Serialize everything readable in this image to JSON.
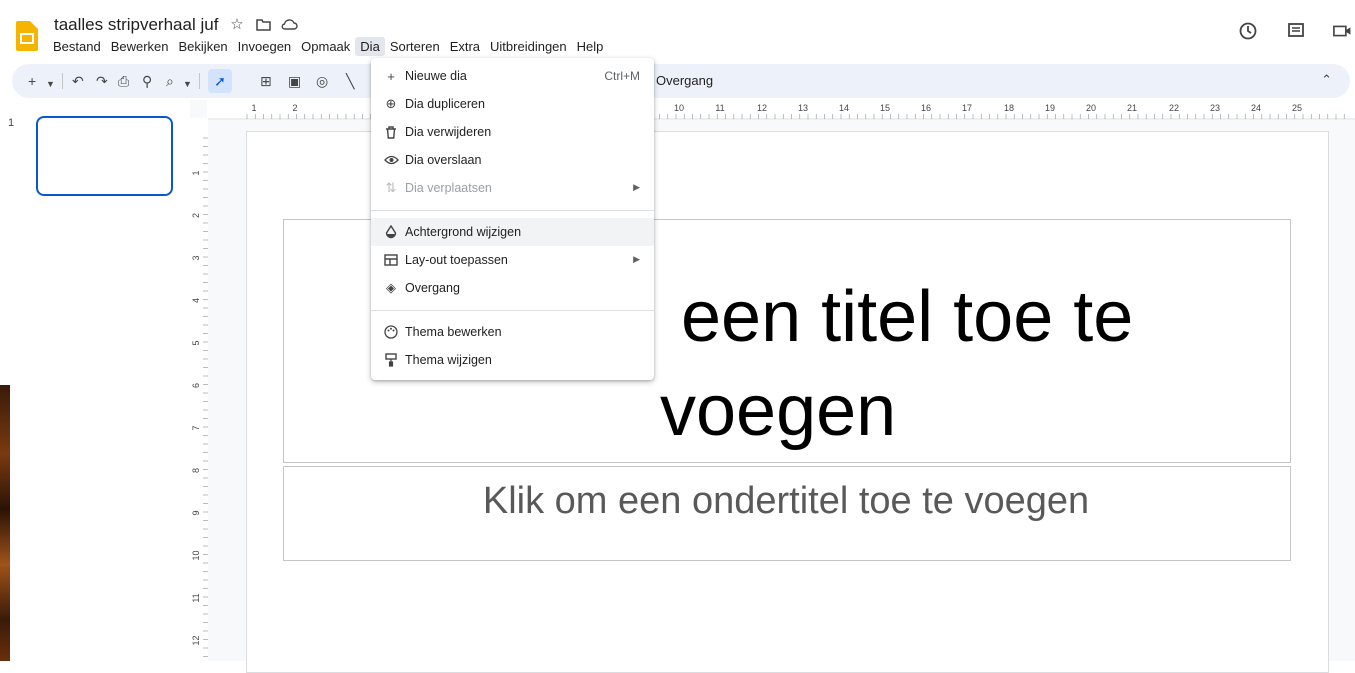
{
  "app": {
    "doc_title": "taalles stripverhaal juf",
    "menus": [
      "Bestand",
      "Bewerken",
      "Bekijken",
      "Invoegen",
      "Opmaak",
      "Dia",
      "Sorteren",
      "Extra",
      "Uitbreidingen",
      "Help"
    ],
    "active_menu": "Dia"
  },
  "toolbar": {
    "transition_label": "Overgang",
    "icons": [
      "plus-icon",
      "dropdown-icon",
      "undo-icon",
      "redo-icon",
      "print-icon",
      "paint-format-icon",
      "zoom-icon",
      "select-icon",
      "textbox-icon",
      "image-icon",
      "shape-icon",
      "line-icon"
    ]
  },
  "ruler": {
    "h_labels": [
      "1",
      "2",
      "10",
      "11",
      "12",
      "13",
      "14",
      "15",
      "16",
      "17",
      "18",
      "19",
      "20",
      "21",
      "22",
      "23",
      "24",
      "25"
    ],
    "v_labels": [
      "1",
      "2",
      "3",
      "4",
      "5",
      "6",
      "7",
      "8",
      "9",
      "10",
      "11",
      "12"
    ]
  },
  "filmstrip": {
    "slide_number": "1"
  },
  "slide": {
    "title_line1": "een titel toe te",
    "title_line2": "voegen",
    "subtitle": "Klik om een ondertitel toe te voegen"
  },
  "dia_menu": {
    "items": [
      {
        "label": "Nieuwe dia",
        "shortcut": "Ctrl+M",
        "icon": "plus-icon"
      },
      {
        "label": "Dia dupliceren",
        "icon": "duplicate-icon"
      },
      {
        "label": "Dia verwijderen",
        "icon": "trash-icon"
      },
      {
        "label": "Dia overslaan",
        "icon": "eye-icon"
      },
      {
        "label": "Dia verplaatsen",
        "icon": "move-icon",
        "disabled": true,
        "submenu": true
      },
      {
        "label": "Achtergrond wijzigen",
        "icon": "fill-drop-icon"
      },
      {
        "label": "Lay-out toepassen",
        "icon": "layout-icon",
        "submenu": true
      },
      {
        "label": "Overgang",
        "icon": "transition-icon"
      },
      {
        "label": "Thema bewerken",
        "icon": "palette-icon"
      },
      {
        "label": "Thema wijzigen",
        "icon": "paint-roller-icon"
      }
    ]
  },
  "colors": {
    "accent": "#0b57d0",
    "toolbar_bg": "#edf2fa",
    "app_icon": "#f4b400"
  }
}
